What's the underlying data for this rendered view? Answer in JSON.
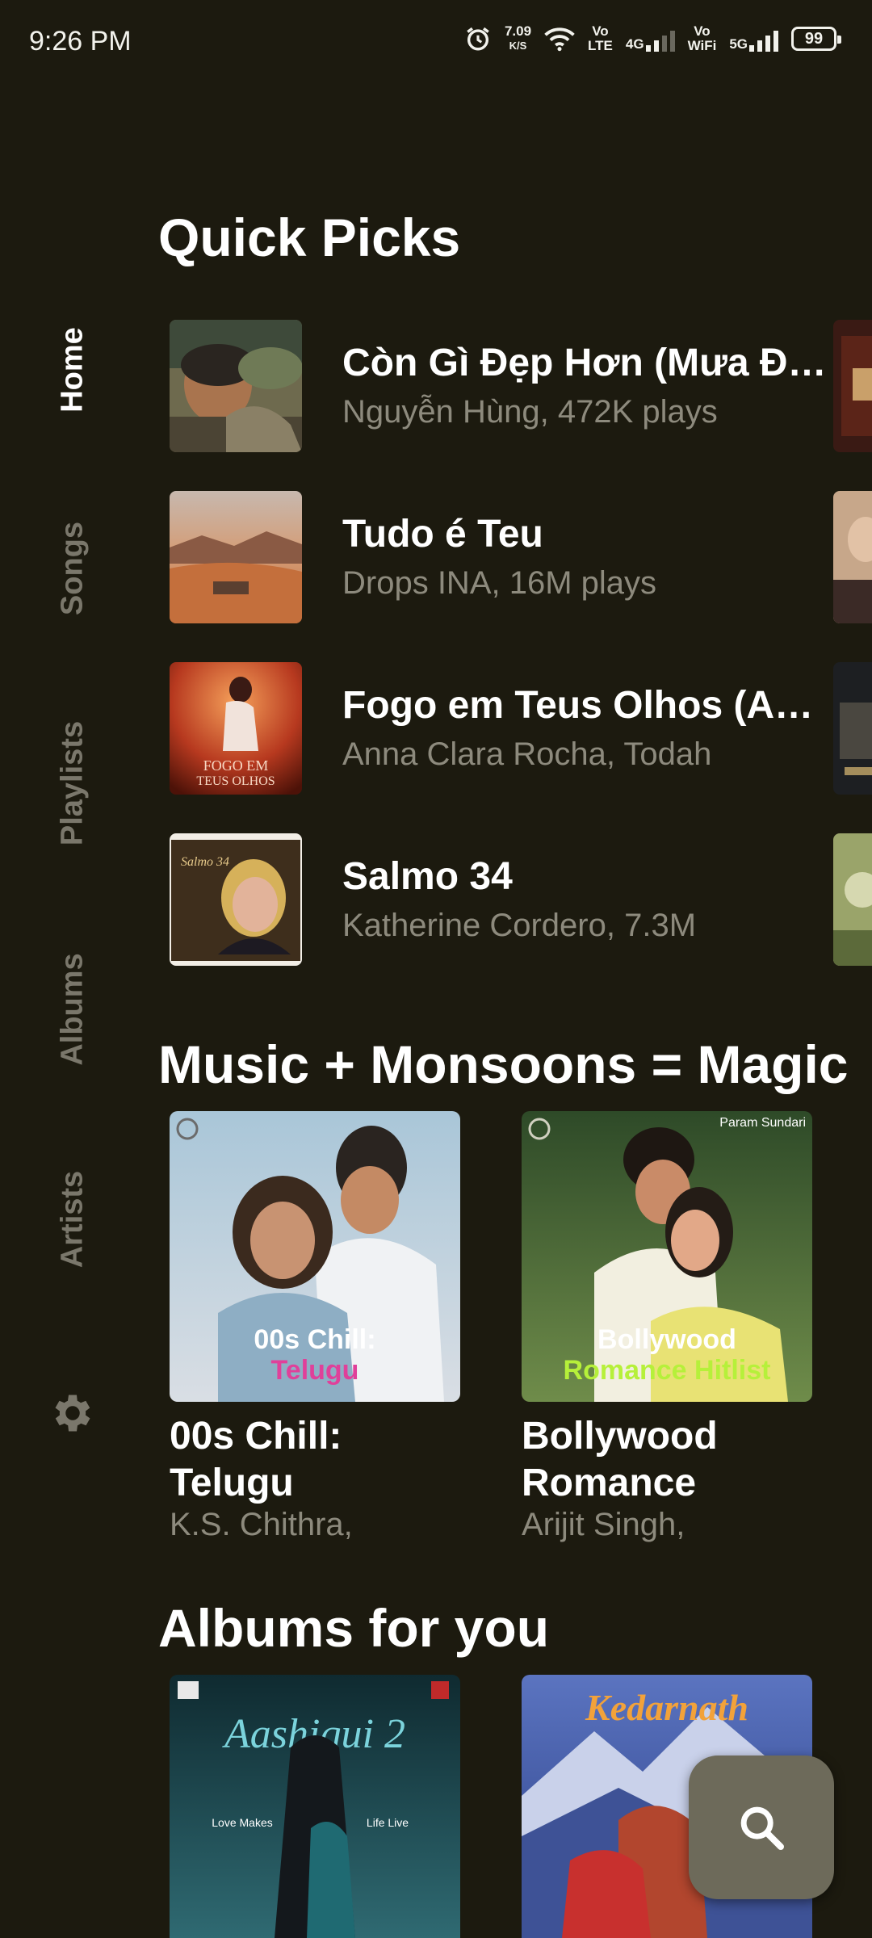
{
  "status": {
    "time": "9:26 PM",
    "net_speed_value": "7.09",
    "net_speed_unit": "K/S",
    "volte_top": "Vo",
    "volte_bottom": "LTE",
    "net_4g": "4G",
    "wifi_top": "Vo",
    "wifi_bottom": "WiFi",
    "net_5g": "5G",
    "battery": "99"
  },
  "nav": {
    "home": "Home",
    "songs": "Songs",
    "playlists": "Playlists",
    "albums": "Albums",
    "artists": "Artists",
    "active": "Home"
  },
  "quick_picks": {
    "heading": "Quick Picks",
    "items": [
      {
        "title": "Còn Gì Đẹp Hơn (Mưa Đỏ Original Soundtrack)",
        "subtitle": "Nguyễn Hùng, 472K plays"
      },
      {
        "title": "Tudo é Teu",
        "subtitle": "Drops INA, 16M plays"
      },
      {
        "title": "Fogo em Teus Olhos (Ao Vivo)",
        "subtitle": "Anna Clara Rocha, Todah"
      },
      {
        "title": "Salmo 34",
        "subtitle": "Katherine Cordero, 7.3M"
      }
    ],
    "art_texts": {
      "fogo_line1": "FOGO EM",
      "fogo_line2": "TEUS OLHOS",
      "salmo": "Salmo 34"
    }
  },
  "monsoon": {
    "heading": "Music + Monsoons = Magic",
    "cards": [
      {
        "title": "00s Chill: Telugu",
        "subtitle": "K.S. Chithra,",
        "art_line1": "00s Chill:",
        "art_line2": "Telugu",
        "art_line2_color": "#e0409a"
      },
      {
        "title": "Bollywood Romance",
        "subtitle": "Arijit Singh,",
        "art_line1": "Bollywood",
        "art_line2": "Romance Hitlist",
        "art_line2_color": "#b6f03a",
        "art_tag": "Param Sundari"
      }
    ]
  },
  "albums": {
    "heading": "Albums for you",
    "cards": [
      {
        "art_title": "Aashiqui 2",
        "art_tag_left": "Love Makes",
        "art_tag_right": "Life Live"
      },
      {
        "art_title": "Kedarnath"
      }
    ]
  },
  "fab": {
    "icon": "search-icon"
  },
  "colors": {
    "background": "#1c1a0f",
    "muted_text": "#8d8a7d",
    "nav_inactive": "#7a776b",
    "fab": "#6d6a5a"
  }
}
